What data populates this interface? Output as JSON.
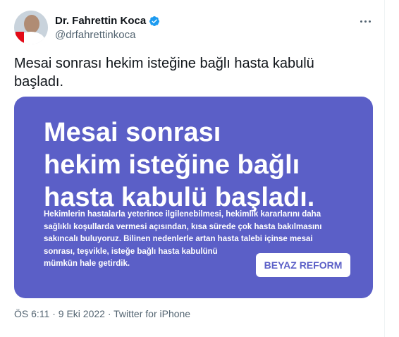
{
  "author": {
    "display_name": "Dr. Fahrettin Koca",
    "handle": "@drfahrettinkoca"
  },
  "tweet": {
    "text": "Mesai sonrası hekim isteğine bağlı hasta kabulü başladı."
  },
  "media": {
    "title_lines": [
      "Mesai sonrası",
      "hekim isteğine bağlı",
      "hasta kabulü başladı."
    ],
    "body_lines": [
      "Hekimlerin hastalarla yeterince ilgilenebilmesi, hekimlik kararlarını daha",
      "sağlıklı koşullarda vermesi açısından, kısa sürede çok hasta bakılmasını",
      "sakıncalı buluyoruz. Bilinen nedenlerle artan hasta talebi içinse mesai",
      "sonrası, teşvikle, isteğe bağlı hasta kabulünü",
      "mümkün hale getirdik."
    ],
    "badge": "BEYAZ REFORM"
  },
  "meta": {
    "time": "ÖS 6:11",
    "date": "9 Eki 2022",
    "source": "Twitter for iPhone",
    "separator": "·"
  },
  "colors": {
    "media_bg": "#5b5fc7",
    "verified": "#1d9bf0"
  },
  "icons": [
    "verified-badge-icon",
    "more-options-icon"
  ]
}
